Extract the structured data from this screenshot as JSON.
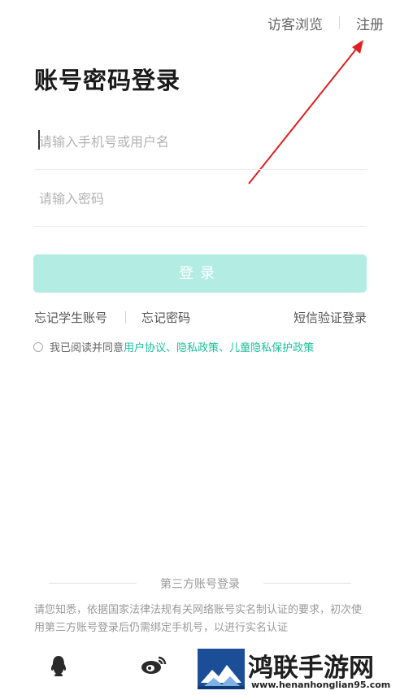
{
  "topbar": {
    "guest_label": "访客浏览",
    "register_label": "注册"
  },
  "title": "账号密码登录",
  "username": {
    "placeholder": "请输入手机号或用户名"
  },
  "password": {
    "placeholder": "请输入密码"
  },
  "login_button": "登录",
  "links": {
    "forgot_student": "忘记学生账号",
    "forgot_password": "忘记密码",
    "sms_login": "短信验证登录"
  },
  "agreement": {
    "prefix": "我已阅读并同意",
    "terms": "用户协议",
    "sep1": "、",
    "privacy": "隐私政策",
    "sep2": "、",
    "child_privacy": "儿童隐私保护政策"
  },
  "third_party": {
    "title": "第三方账号登录",
    "notice": "请您知悉，依据国家法律法规有关网络账号实名制认证的要求，初次使用第三方账号登录后仍需绑定手机号，以进行实名认证"
  },
  "watermark": {
    "name": "鸿联手游网",
    "url": "www.henanhonglian95.com"
  },
  "colors": {
    "accent": "#1ac0a0",
    "button_bg": "#b3ece3",
    "annotation_arrow": "#e02020"
  }
}
